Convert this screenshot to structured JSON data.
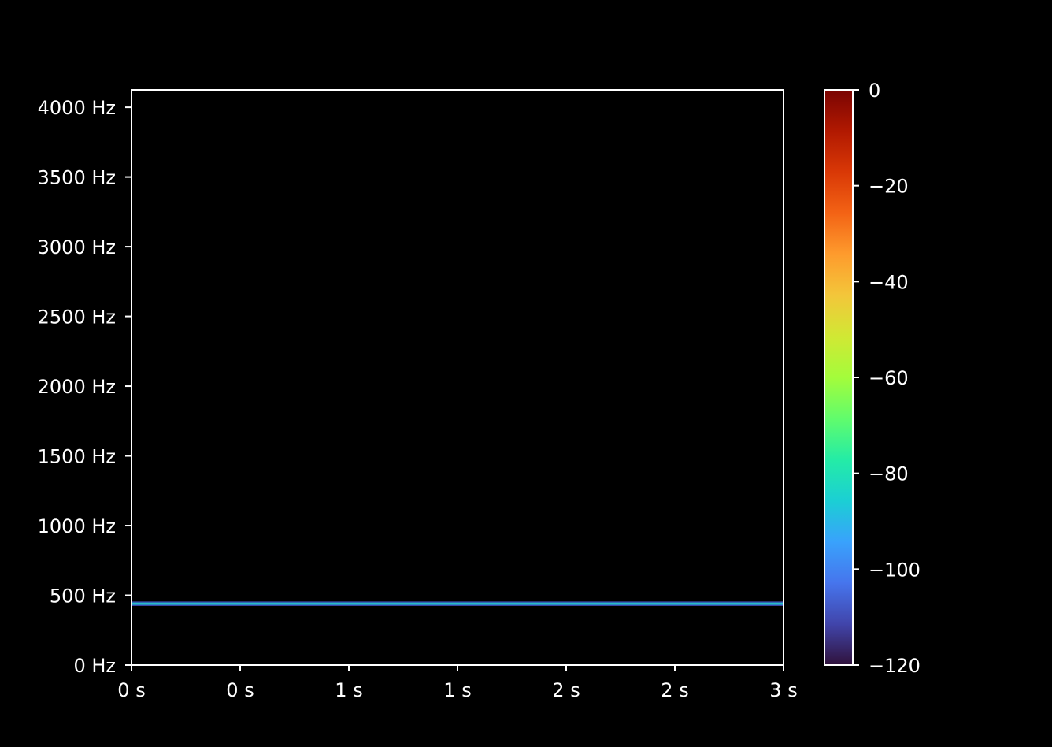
{
  "chart_data": {
    "type": "heatmap",
    "title": "",
    "xlabel": "",
    "ylabel": "",
    "x_tick_labels": [
      "0 s",
      "0 s",
      "1 s",
      "1 s",
      "2 s",
      "2 s",
      "3 s"
    ],
    "x_tick_values": [
      0,
      0.5,
      1,
      1.5,
      2,
      2.5,
      3
    ],
    "xlim": [
      0,
      3
    ],
    "y_tick_labels": [
      "0 Hz",
      "500 Hz",
      "1000 Hz",
      "1500 Hz",
      "2000 Hz",
      "2500 Hz",
      "3000 Hz",
      "3500 Hz",
      "4000 Hz"
    ],
    "y_tick_values": [
      0,
      500,
      1000,
      1500,
      2000,
      2500,
      3000,
      3500,
      4000
    ],
    "ylim": [
      0,
      4125
    ],
    "colorbar": {
      "tick_labels": [
        "0",
        "−20",
        "−40",
        "−60",
        "−80",
        "−100",
        "−120"
      ],
      "tick_values": [
        0,
        -20,
        -40,
        -60,
        -80,
        -100,
        -120
      ],
      "range": [
        -120,
        0
      ],
      "colormap": "turbo",
      "colors": [
        "#30123b",
        "#4145ab",
        "#4675ed",
        "#39a2fc",
        "#1bcfd4",
        "#24eca6",
        "#61fc6c",
        "#a4fc3b",
        "#d1e834",
        "#f3c63a",
        "#fe9b2d",
        "#f36315",
        "#d93806",
        "#b11901",
        "#7a0402"
      ]
    },
    "grid": false,
    "background": "#000000",
    "series": [
      {
        "band_center_hz": 440,
        "band_rows": [
          {
            "freq_hz": 427,
            "db": -110
          },
          {
            "freq_hz": 433,
            "db": -95
          },
          {
            "freq_hz": 437,
            "db": -80
          },
          {
            "freq_hz": 440,
            "db": -65
          },
          {
            "freq_hz": 443,
            "db": -80
          },
          {
            "freq_hz": 447,
            "db": -95
          },
          {
            "freq_hz": 453,
            "db": -110
          }
        ],
        "t_start": 0,
        "t_end": 3
      }
    ]
  }
}
